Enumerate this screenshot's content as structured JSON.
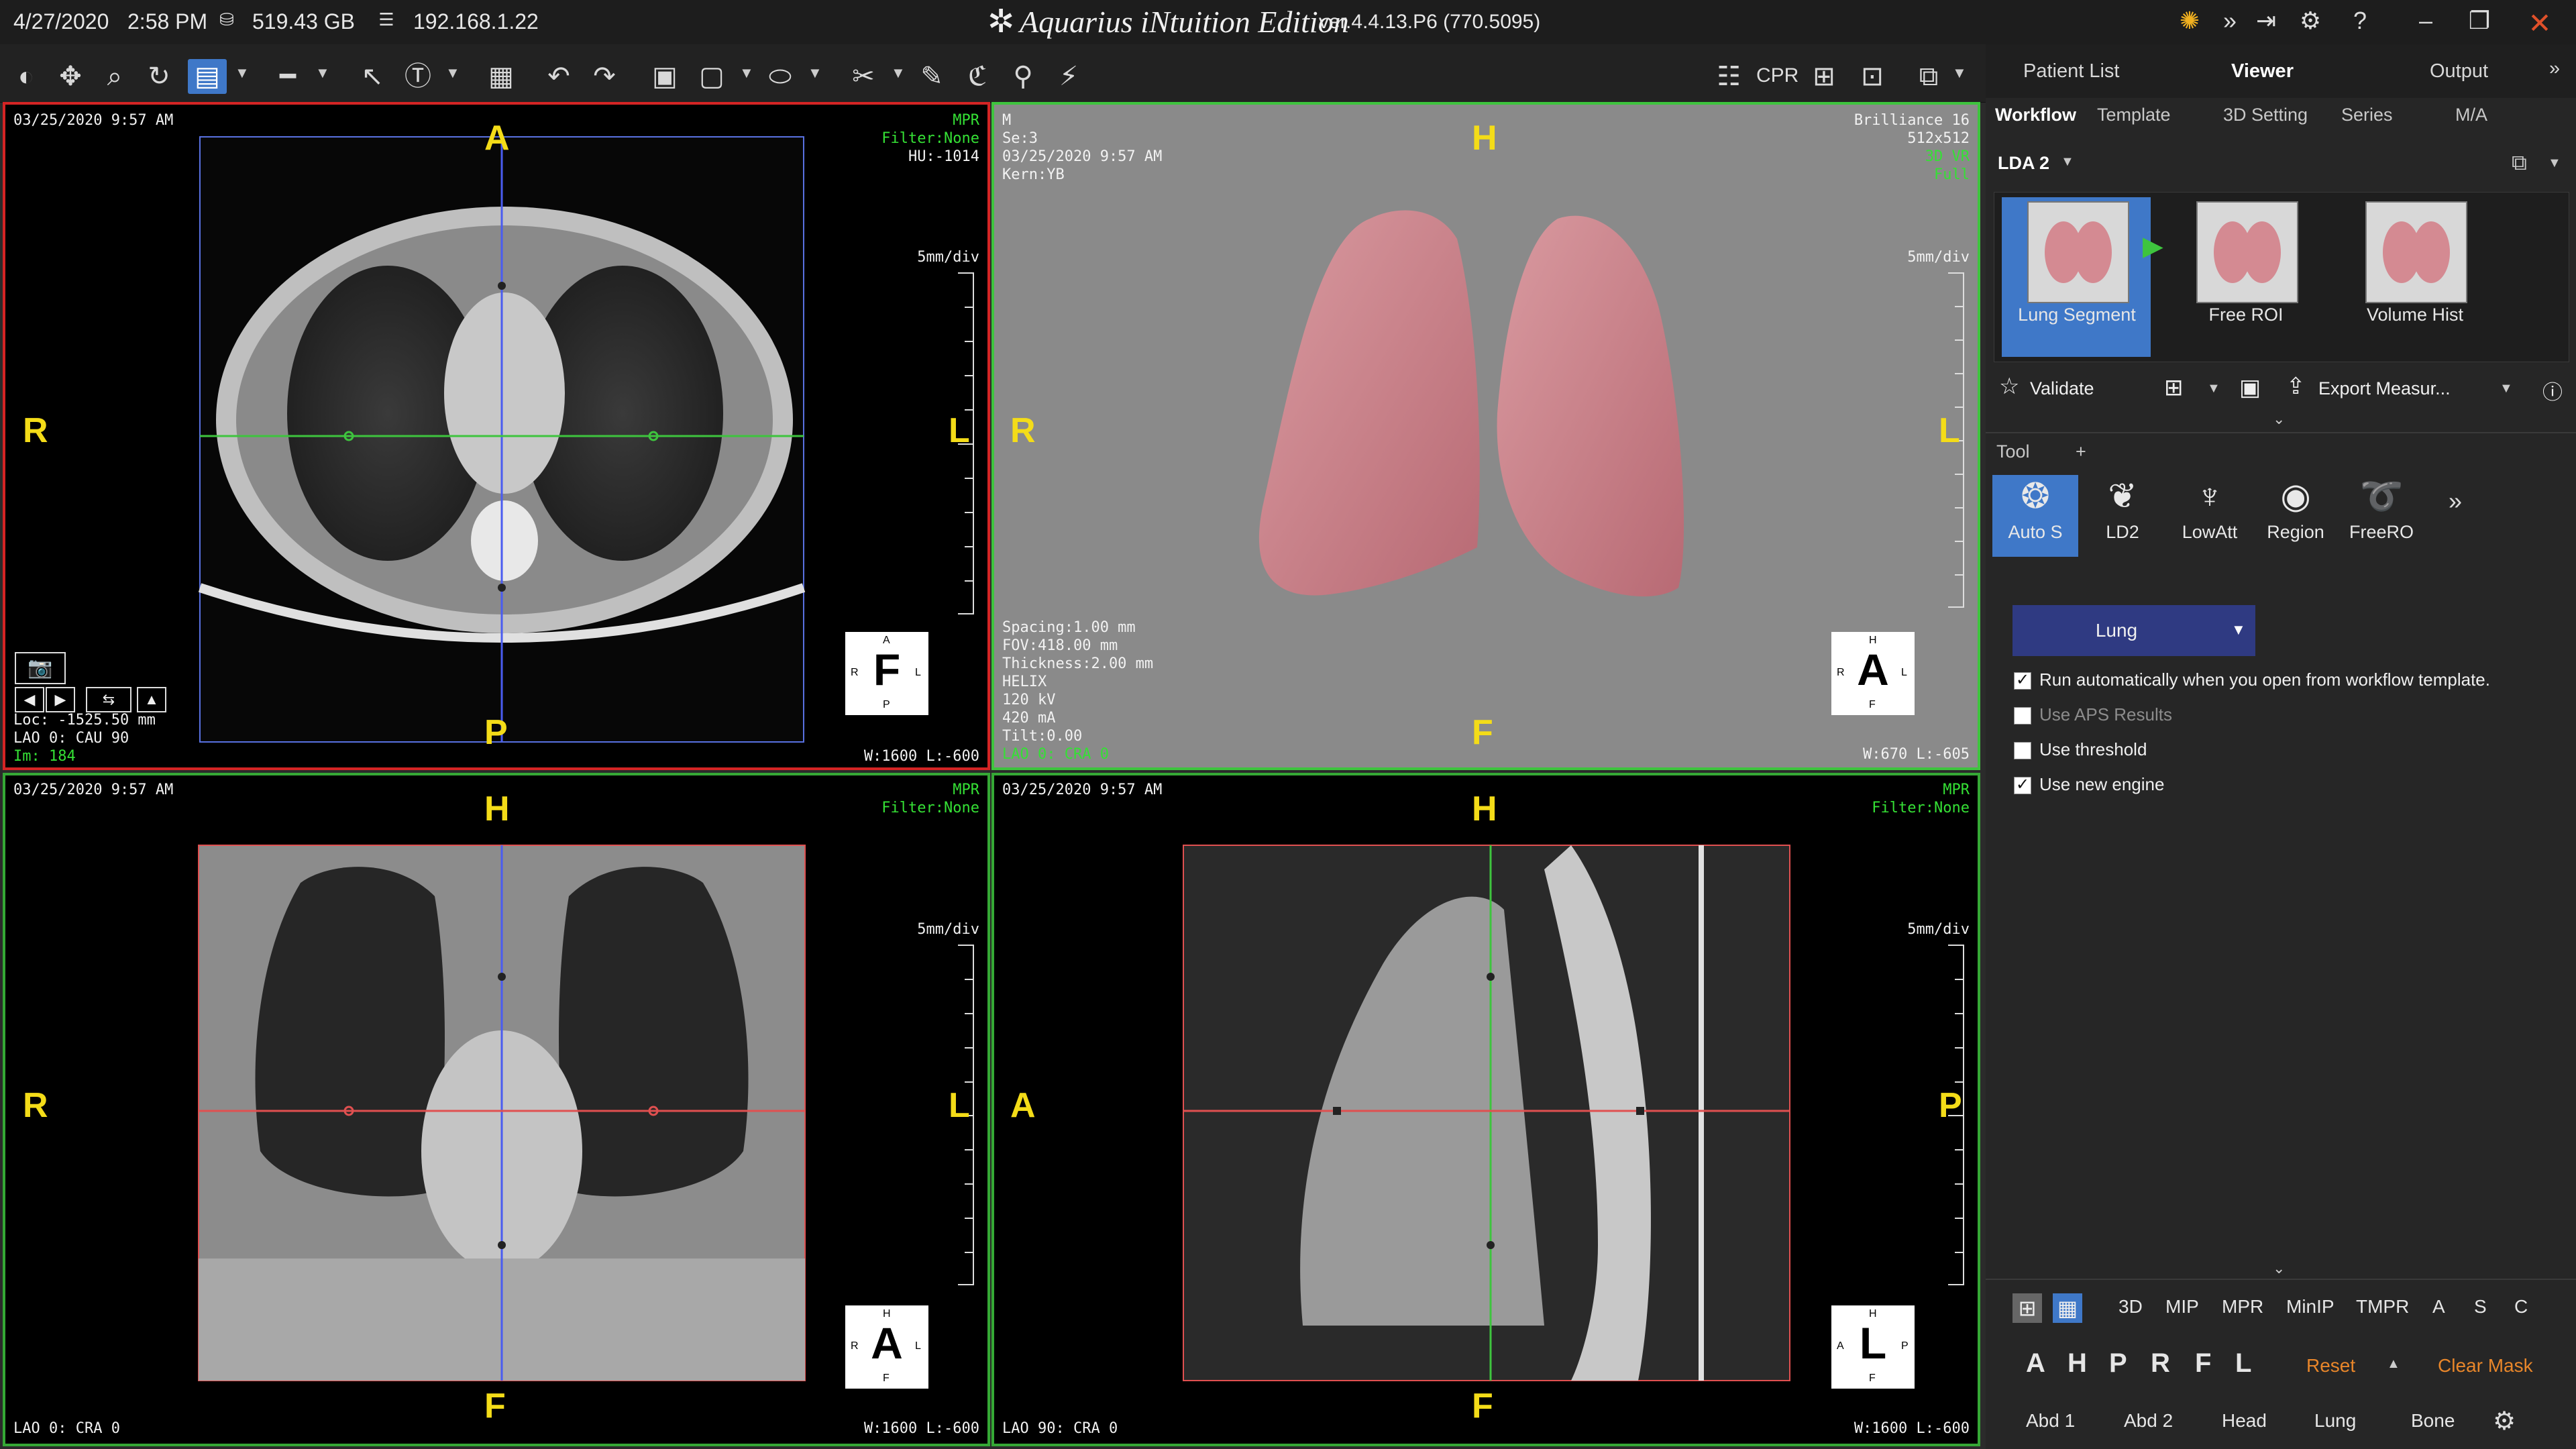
{
  "titlebar": {
    "date": "4/27/2020",
    "time": "2:58 PM",
    "disk": "519.43 GB",
    "ip": "192.168.1.22",
    "app_name": "Aquarius iNtuition Edition",
    "version": "ver.4.4.13.P6 (770.5095)"
  },
  "toolbar": {
    "cpr_label": "CPR"
  },
  "viewports": {
    "axial": {
      "datetime": "03/25/2020 9:57 AM",
      "mode": "MPR",
      "filter": "Filter:None",
      "hu": "HU:-1014",
      "scale": "5mm/div",
      "loc": "Loc: -1525.50 mm",
      "angle": "LAO 0: CAU 90",
      "image": "Im: 184",
      "wl": "W:1600 L:-600",
      "top": "A",
      "bottom": "P",
      "left": "R",
      "right": "L",
      "cube": {
        "center": "F",
        "top": "A",
        "bottom": "P",
        "left": "R",
        "right": "L"
      }
    },
    "volume": {
      "patient": "M",
      "series": "Se:3",
      "datetime": "03/25/2020 9:57 AM",
      "kernel": "Kern:YB",
      "scanner": "Brilliance 16",
      "matrix": "512x512",
      "render": "3D VR",
      "quality": "Full",
      "scale": "5mm/div",
      "spacing": "Spacing:1.00 mm",
      "fov": "FOV:418.00 mm",
      "thickness": "Thickness:2.00 mm",
      "helix": "HELIX",
      "kv": "120 kV",
      "ma": "420 mA",
      "tilt": "Tilt:0.00",
      "angle": "LAO 0: CRA 0",
      "wl": "W:670 L:-605",
      "top": "H",
      "bottom": "F",
      "left": "R",
      "right": "L",
      "cube": {
        "center": "A",
        "top": "H",
        "bottom": "F",
        "left": "R",
        "right": "L"
      }
    },
    "coronal": {
      "datetime": "03/25/2020 9:57 AM",
      "mode": "MPR",
      "filter": "Filter:None",
      "scale": "5mm/div",
      "angle": "LAO 0: CRA 0",
      "wl": "W:1600 L:-600",
      "top": "H",
      "bottom": "F",
      "left": "R",
      "right": "L",
      "cube": {
        "center": "A",
        "top": "H",
        "bottom": "F",
        "left": "R",
        "right": "L"
      }
    },
    "sagittal": {
      "datetime": "03/25/2020 9:57 AM",
      "mode": "MPR",
      "filter": "Filter:None",
      "scale": "5mm/div",
      "angle": "LAO 90: CRA 0",
      "wl": "W:1600 L:-600",
      "top": "H",
      "bottom": "F",
      "left": "A",
      "right": "P",
      "cube": {
        "center": "L",
        "top": "H",
        "bottom": "F",
        "left": "A",
        "right": "P"
      }
    }
  },
  "panel": {
    "top_tabs": [
      "Patient List",
      "Viewer",
      "Output"
    ],
    "sub_tabs": [
      "Workflow",
      "Template",
      "3D Setting",
      "Series",
      "M/A"
    ],
    "workflow_name": "LDA 2",
    "steps": [
      "Lung Segment",
      "Free ROI",
      "Volume Hist"
    ],
    "validate": "Validate",
    "export": "Export Measur...",
    "tool_label": "Tool",
    "tool_add": "+",
    "tools": [
      "Auto S",
      "LD2",
      "LowAtt",
      "Region",
      "FreeRO"
    ],
    "lung_select": "Lung",
    "options": [
      {
        "label": "Run automatically when you open from workflow template.",
        "checked": true
      },
      {
        "label": "Use APS Results",
        "checked": false
      },
      {
        "label": "Use threshold",
        "checked": false
      },
      {
        "label": "Use new engine",
        "checked": true
      }
    ],
    "render_modes": [
      "3D",
      "MIP",
      "MPR",
      "MinIP",
      "TMPR",
      "A",
      "S",
      "C"
    ],
    "orient_buttons": [
      "A",
      "H",
      "P",
      "R",
      "F",
      "L"
    ],
    "reset": "Reset",
    "clear_mask": "Clear Mask",
    "presets": [
      "Abd 1",
      "Abd 2",
      "Head",
      "Lung",
      "Bone"
    ]
  },
  "colors": {
    "accent": "#3f78c8",
    "active_viewport": "#d42424",
    "viewport_border": "#35a835",
    "orientation_text": "#f4dc18",
    "overlay_green": "#35e035",
    "orange_text": "#e8862a"
  }
}
